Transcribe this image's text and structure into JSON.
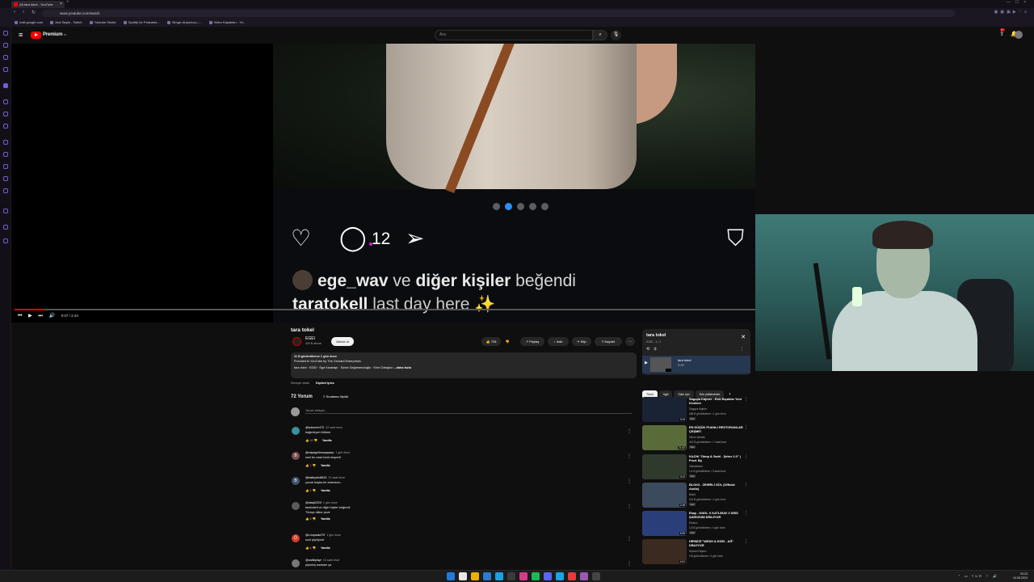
{
  "browser": {
    "tab_title": "(9) tara tokel - YouTube",
    "url": "www.youtube.com/watch",
    "bookmarks": [
      "mail.google.com",
      "Ana Sayfa - Twitch",
      "Youtube Studio",
      "Spotify for Podcasts...",
      "Simge oluşturucu -...",
      "Video Kapakları - Yo..."
    ]
  },
  "header": {
    "logo_text": "Premium",
    "logo_country": "TR",
    "search_placeholder": "Ara",
    "notification_count": "9+"
  },
  "player": {
    "time": "0:07 / 2:44",
    "progress_fraction": 0.04,
    "carousel_total": 5,
    "carousel_active": 2,
    "post_comment_count": "12",
    "post_likers": {
      "first": "ege_wav",
      "connector": "ve",
      "others": "diğer kişiler",
      "suffix": "beğendi"
    },
    "post_caption": {
      "user": "taratokell",
      "text": "last day here ✨"
    }
  },
  "video": {
    "title": "tara tokel",
    "channel": "EGEI",
    "subscribers": "420 B abone",
    "subscribe_label": "Abone ol",
    "likes": "728",
    "share_label": "Paylaş",
    "download_label": "İndir",
    "clip_label": "Klip",
    "save_label": "Kaydet",
    "description": {
      "views": "11 B görüntüleme  1 gün önce",
      "line1": "Provided to YouTube by The Orchard Enterprises",
      "line2": "tara tokel · EGEI · Ege Karataşlı · Soner Değirmencioğlu · Emir Öztaşkın",
      "more": "...daha fazla"
    },
    "music_label": "Eleveyin sesini",
    "explicit_label": "Explicit lyrics"
  },
  "comments": {
    "count_label": "72 Yorum",
    "sort_label": "Sıralama ölçütü",
    "add_placeholder": "Yorum ekleyin...",
    "reply_label": "Yanıtla",
    "items": [
      {
        "author": "@sulocenr472",
        "time": "22 saat önce",
        "text": "bağımlıyım tütüme",
        "likes": "10",
        "avatar_color": "#3c8f9e",
        "initial": ""
      },
      {
        "author": "@mtpsyphbwopspsep",
        "time": "1 gün önce",
        "text": "soni bu nasıl beat respect!",
        "likes": "7",
        "avatar_color": "#7b4e4e",
        "initial": "B"
      },
      {
        "author": "@baileydiniti515",
        "time": "21 saat önce",
        "text": "çocuk başka bir adamson...",
        "likes": "2",
        "avatar_color": "#40546e",
        "initial": "B"
      },
      {
        "author": "@dawji2229",
        "time": "1 gün önce",
        "text": "taratokell ve diğer kişiler beğendi",
        "text2": "Türkçe diline çevir",
        "likes": "6",
        "avatar_color": "#5a5a5a",
        "initial": ""
      },
      {
        "author": "@o.bopsak479",
        "time": "1 gün önce",
        "text": "soni pişiriyorrr",
        "likes": "4",
        "avatar_color": "#d23d2a",
        "initial": "Ö"
      },
      {
        "author": "@cadikplayr",
        "time": "10 saat önce",
        "text": "pişirmiş kankam ya",
        "likes": "",
        "avatar_color": "#777",
        "initial": ""
      }
    ]
  },
  "playlist": {
    "title": "tara tokel",
    "subtitle": "EGEI - 1 / 1",
    "item_title": "tara tokel",
    "item_channel": "EGEI",
    "item_duration": "2:44"
  },
  "chips": [
    "Tümü",
    "İlgili",
    "Sizin için",
    "Son yüklenenler"
  ],
  "recommendations": [
    {
      "title": "Sagopa Kajmer - Eski Bıçaklar Yeni Kesikler",
      "channel": "Sagopa Kajmer",
      "views": "456 B görüntüleme • 1 gün önce",
      "duration": "3:24",
      "badge": "Yeni",
      "bg": "#1a2333"
    },
    {
      "title": "EN DÜŞÜK PUANLI RESTORANLAR ÇEŞME!",
      "channel": "Orkun Işıtmak",
      "views": "401 B görüntüleme • 7 saat önce",
      "duration": "21:52",
      "badge": "Yeni",
      "bg": "#5a6b3a"
    },
    {
      "title": "KACHI \"Dimp & Swirl - Şeker 2.0\" | Prod. By",
      "channel": "Ofasulktonil",
      "views": "1,4 B görüntüleme • 3 saat önce",
      "duration": "3:02",
      "badge": "Yeni",
      "bg": "#2f3a2d"
    },
    {
      "title": "BLOK3 - ZEHİRLİ GÜL (Official Audio)",
      "channel": "Blok3",
      "views": "114 B görüntüleme • 1 gün önce",
      "duration": "2:48",
      "badge": "Yeni",
      "bg": "#3b4a5c"
    },
    {
      "title": "Ekay - KNGL X KATLİHAV 2 DİSS ŞARKISINI DİNLİYOR",
      "channel": "Ekuhun",
      "views": "1,8 B görüntüleme • 4 gün önce",
      "duration": "8:59",
      "badge": "Yeni",
      "bg": "#2a3f7a"
    },
    {
      "title": "HİPNEZİ \"WESH & EGEI - AĞ\" DİNLİYOR",
      "channel": "Hipnezi Dejavu",
      "views": "3 B görüntüleme • 3 gün önce",
      "duration": "4:51",
      "badge": "",
      "bg": "#3a2a1f"
    }
  ],
  "taskbar": {
    "lang": "TUR",
    "time": "00:23",
    "date": "14.08.2024",
    "icon_colors": [
      "#1f7ae0",
      "#e8e8e8",
      "#f0b000",
      "#2a7bd4",
      "#1aa0e6",
      "#3a3a3a",
      "#d83a8a",
      "#1db954",
      "#5865f2",
      "#17a6e8",
      "#e83a3a",
      "#9b59b6",
      "#444"
    ]
  }
}
